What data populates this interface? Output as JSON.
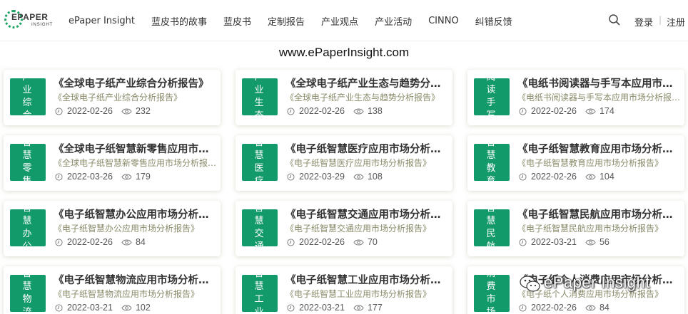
{
  "logo": {
    "text": "EPAPER",
    "sub": "INSIGHT"
  },
  "nav": {
    "items": [
      "ePaper Insight",
      "蓝皮书的故事",
      "蓝皮书",
      "定制报告",
      "产业观点",
      "产业活动",
      "CINNO",
      "纠错反馈"
    ],
    "login": "登录",
    "separator": "|",
    "register": "注册"
  },
  "site_url": "www.ePaperInsight.com",
  "colors": {
    "tile": "#129a6b",
    "subtitle": "#8a8a6a"
  },
  "cards": [
    {
      "tile": "产业综合",
      "title": "《全球电子纸产业综合分析报告》",
      "subtitle": "《全球电子纸产业综合分析报告》",
      "date": "2022-02-26",
      "views": "232"
    },
    {
      "tile": "产业生态",
      "title": "《全球电子纸产业生态与趋势分析报告》",
      "subtitle": "《全球电子纸产业生态与趋势分析报告》",
      "date": "2022-02-26",
      "views": "138"
    },
    {
      "tile": "阅读手写",
      "title": "《电纸书阅读器与手写本应用市场分析报告》",
      "subtitle": "《电纸书阅读器与手写本应用市场分析报告》",
      "date": "2022-02-26",
      "views": "174"
    },
    {
      "tile": "智慧零售",
      "title": "《全球电子纸智慧新零售应用市场分析报告》",
      "subtitle": "《全球电子纸智慧新零售应用市场分析报告》",
      "date": "2022-03-26",
      "views": "179"
    },
    {
      "tile": "智慧医疗",
      "title": "《电子纸智慧医疗应用市场分析报告》",
      "subtitle": "《电子纸智慧医疗应用市场分析报告》",
      "date": "2022-03-29",
      "views": "108"
    },
    {
      "tile": "智慧教育",
      "title": "《电子纸智慧教育应用市场分析报告》",
      "subtitle": "《电子纸智慧教育应用市场分析报告》",
      "date": "2022-02-26",
      "views": "104"
    },
    {
      "tile": "智慧办公",
      "title": "《电子纸智慧办公应用市场分析报告》",
      "subtitle": "《电子纸智慧办公应用市场分析报告》",
      "date": "2022-02-26",
      "views": "84"
    },
    {
      "tile": "智慧交通",
      "title": "《电子纸智慧交通应用市场分析报告》",
      "subtitle": "《电子纸智慧交通应用市场分析报告》",
      "date": "2022-02-26",
      "views": "70"
    },
    {
      "tile": "智慧民航",
      "title": "《电子纸智慧民航应用市场分析报告》",
      "subtitle": "《电子纸智慧民航应用市场分析报告》",
      "date": "2022-03-21",
      "views": "56"
    },
    {
      "tile": "智慧物流",
      "title": "《电子纸智慧物流应用市场分析报告》",
      "subtitle": "《电子纸智慧物流应用市场分析报告》",
      "date": "2022-03-21",
      "views": "102"
    },
    {
      "tile": "智慧工业",
      "title": "《电子纸智慧工业应用市场分析报告》",
      "subtitle": "《电子纸智慧工业应用市场分析报告》",
      "date": "2022-03-21",
      "views": "177"
    },
    {
      "tile": "消费市场",
      "title": "《电子纸个人消费应用市场分析报告》",
      "subtitle": "《电子纸个人消费应用市场分析报告》",
      "date": "2022-02-26",
      "views": "84"
    }
  ],
  "watermark": {
    "text": "ePaper Insight",
    "icon": "wechat-icon"
  }
}
